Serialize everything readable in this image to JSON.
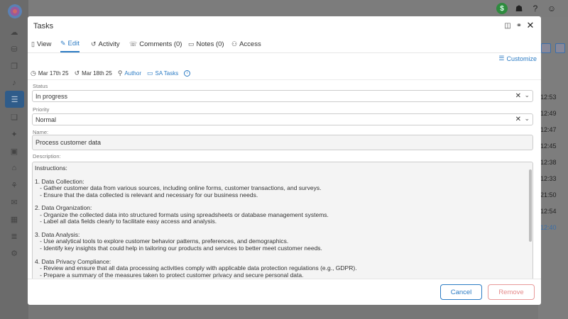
{
  "modal": {
    "title": "Tasks",
    "tabs": [
      {
        "label": "View",
        "icon": "document-icon"
      },
      {
        "label": "Edit",
        "icon": "edit-icon",
        "active": true
      },
      {
        "label": "Activity",
        "icon": "history-icon"
      },
      {
        "label": "Comments (0)",
        "icon": "comments-icon"
      },
      {
        "label": "Notes (0)",
        "icon": "clipboard-icon"
      },
      {
        "label": "Access",
        "icon": "users-icon"
      }
    ],
    "customize_label": "Customize",
    "meta": {
      "created": "Mar 17th 25",
      "updated": "Mar 18th 25",
      "author": "Author",
      "project": "SA Tasks"
    },
    "fields": {
      "status_label": "Status",
      "status_value": "In progress",
      "priority_label": "Priority",
      "priority_value": "Normal",
      "name_label": "Name:",
      "name_value": "Process customer data",
      "description_label": "Description:",
      "description_value": "Instructions:\n\n1. Data Collection:\n   - Gather customer data from various sources, including online forms, customer transactions, and surveys.\n   - Ensure that the data collected is relevant and necessary for our business needs.\n\n2. Data Organization:\n   - Organize the collected data into structured formats using spreadsheets or database management systems.\n   - Label all data fields clearly to facilitate easy access and analysis.\n\n3. Data Analysis:\n   - Use analytical tools to explore customer behavior patterns, preferences, and demographics.\n   - Identify key insights that could help in tailoring our products and services to better meet customer needs.\n\n4. Data Privacy Compliance:\n   - Review and ensure that all data processing activities comply with applicable data protection regulations (e.g., GDPR).\n   - Prepare a summary of the measures taken to protect customer privacy and secure personal data."
    },
    "buttons": {
      "cancel": "Cancel",
      "remove": "Remove"
    }
  },
  "background": {
    "times": [
      "12:53",
      "12:49",
      "12:47",
      "12:45",
      "12:38",
      "12:33",
      "21:50",
      "12:54",
      "12:40"
    ],
    "colors": {
      "accent": "#2b7bc4",
      "danger": "#e58a8a",
      "success": "#2e8b3e"
    }
  }
}
